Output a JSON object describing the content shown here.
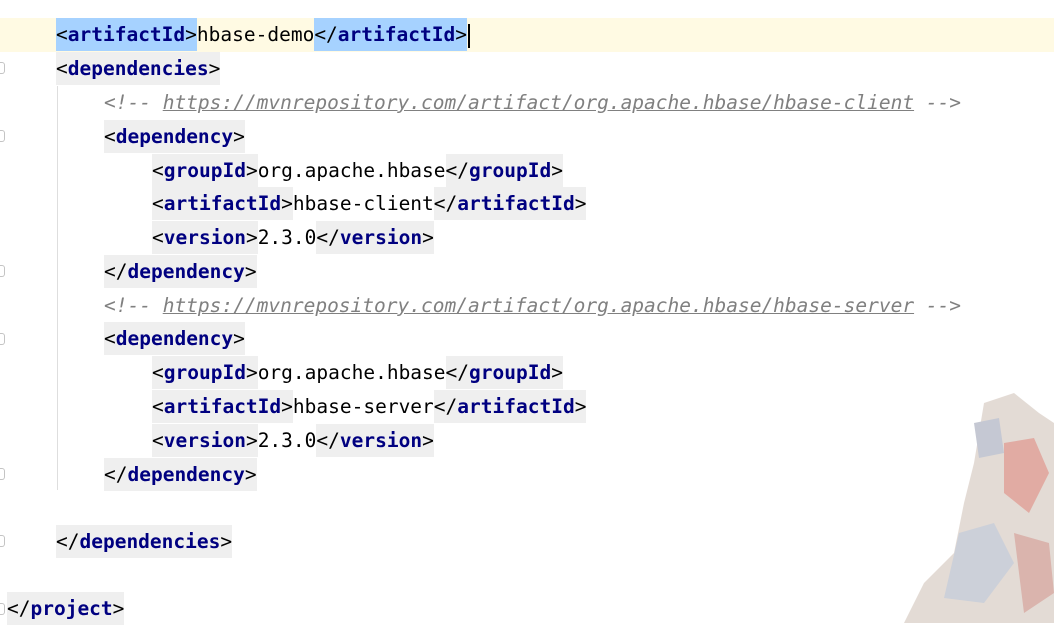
{
  "editor": {
    "lines": [
      {
        "indent": 0,
        "parts": [
          {
            "t": "open",
            "v": "artifactId"
          },
          {
            "t": "text",
            "v": "hbase-demo"
          },
          {
            "t": "close",
            "v": "artifactId"
          }
        ]
      },
      {
        "indent": 0,
        "parts": [
          {
            "t": "open",
            "v": "dependencies"
          }
        ]
      },
      {
        "indent": 1,
        "parts": [
          {
            "t": "comment",
            "pre": "<!-- ",
            "url": "https://mvnrepository.com/artifact/org.apache.hbase/hbase-client",
            "post": " -->"
          }
        ]
      },
      {
        "indent": 1,
        "parts": [
          {
            "t": "open",
            "v": "dependency"
          }
        ]
      },
      {
        "indent": 2,
        "parts": [
          {
            "t": "open",
            "v": "groupId"
          },
          {
            "t": "text",
            "v": "org.apache.hbase"
          },
          {
            "t": "close",
            "v": "groupId"
          }
        ]
      },
      {
        "indent": 2,
        "parts": [
          {
            "t": "open",
            "v": "artifactId"
          },
          {
            "t": "text",
            "v": "hbase-client"
          },
          {
            "t": "close",
            "v": "artifactId"
          }
        ]
      },
      {
        "indent": 2,
        "parts": [
          {
            "t": "open",
            "v": "version"
          },
          {
            "t": "text",
            "v": "2.3.0"
          },
          {
            "t": "close",
            "v": "version"
          }
        ]
      },
      {
        "indent": 1,
        "parts": [
          {
            "t": "close",
            "v": "dependency"
          }
        ]
      },
      {
        "indent": 1,
        "parts": [
          {
            "t": "comment",
            "pre": "<!-- ",
            "url": "https://mvnrepository.com/artifact/org.apache.hbase/hbase-server",
            "post": " -->"
          }
        ]
      },
      {
        "indent": 1,
        "parts": [
          {
            "t": "open",
            "v": "dependency"
          }
        ]
      },
      {
        "indent": 2,
        "parts": [
          {
            "t": "open",
            "v": "groupId"
          },
          {
            "t": "text",
            "v": "org.apache.hbase"
          },
          {
            "t": "close",
            "v": "groupId"
          }
        ]
      },
      {
        "indent": 2,
        "parts": [
          {
            "t": "open",
            "v": "artifactId"
          },
          {
            "t": "text",
            "v": "hbase-server"
          },
          {
            "t": "close",
            "v": "artifactId"
          }
        ]
      },
      {
        "indent": 2,
        "parts": [
          {
            "t": "open",
            "v": "version"
          },
          {
            "t": "text",
            "v": "2.3.0"
          },
          {
            "t": "close",
            "v": "version"
          }
        ]
      },
      {
        "indent": 1,
        "parts": [
          {
            "t": "close",
            "v": "dependency"
          }
        ]
      },
      {
        "indent": 0,
        "parts": []
      },
      {
        "indent": 0,
        "parts": [
          {
            "t": "close",
            "v": "dependencies"
          }
        ]
      },
      {
        "indent": 0,
        "parts": []
      },
      {
        "indent": -1,
        "parts": [
          {
            "t": "close",
            "v": "project"
          }
        ]
      }
    ]
  },
  "colors": {
    "tag_name": "#000080",
    "tag_bg": "#efefef",
    "comment": "#808080",
    "current_line": "#fffae3",
    "selection": "#a6d2ff"
  }
}
